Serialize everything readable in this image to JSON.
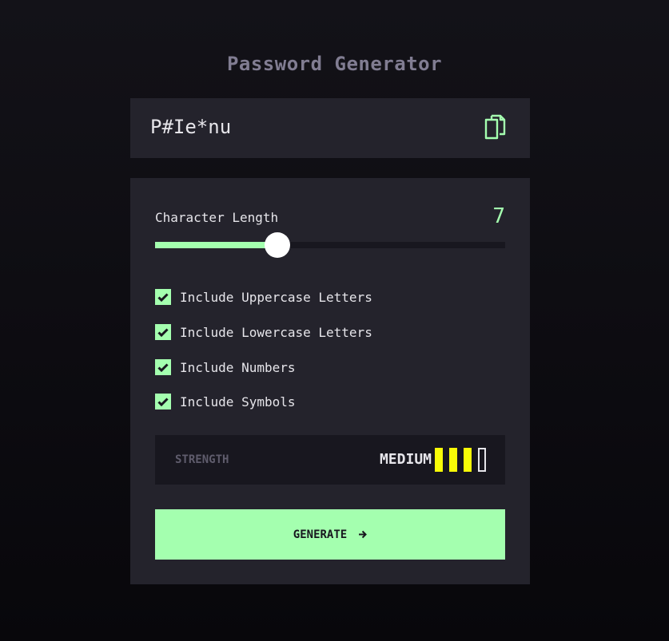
{
  "app": {
    "title": "Password Generator"
  },
  "output": {
    "password": "P#Ie*nu",
    "copy_icon": "copy-icon"
  },
  "length": {
    "label": "Character Length",
    "value": "7",
    "min": 0,
    "max": 20,
    "current": 7
  },
  "options": [
    {
      "label": "Include Uppercase Letters",
      "checked": true
    },
    {
      "label": "Include Lowercase Letters",
      "checked": true
    },
    {
      "label": "Include Numbers",
      "checked": true
    },
    {
      "label": "Include Symbols",
      "checked": true
    }
  ],
  "strength": {
    "label": "STRENGTH",
    "value": "MEDIUM",
    "level": 3,
    "max_level": 4
  },
  "generate": {
    "label": "GENERATE"
  },
  "colors": {
    "accent": "#a4ffaf",
    "medium": "#f8fc07",
    "panel": "#24232c",
    "dark": "#18171f",
    "text": "#e6e5ea",
    "muted": "#817d92"
  }
}
